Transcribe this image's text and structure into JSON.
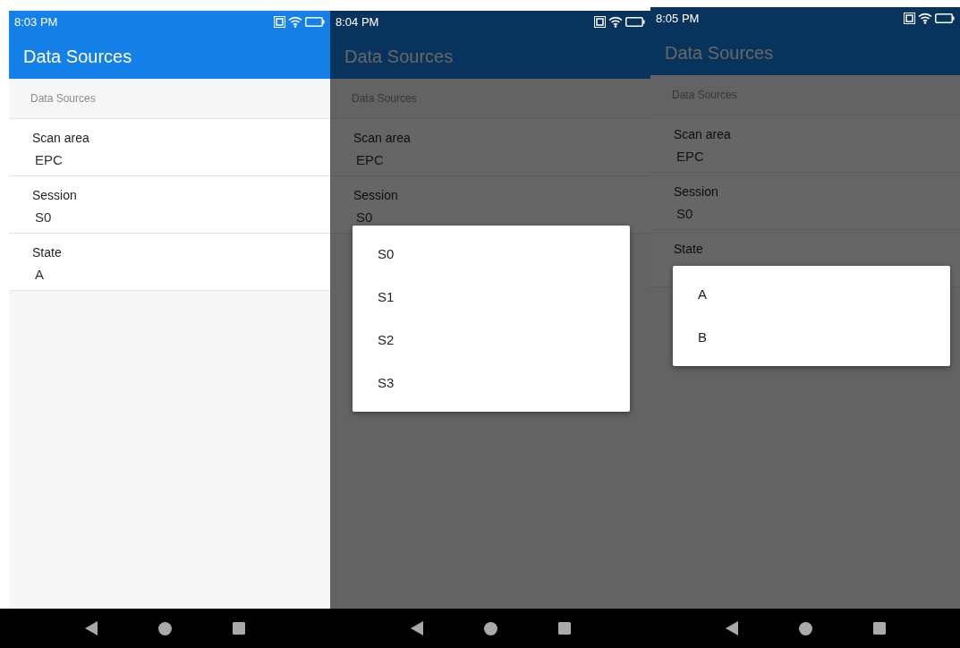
{
  "screens": [
    {
      "time": "8:03 PM",
      "title": "Data Sources",
      "dimmed": false,
      "section_header": "Data Sources",
      "items": [
        {
          "label": "Scan area",
          "value": "EPC"
        },
        {
          "label": "Session",
          "value": "S0"
        },
        {
          "label": "State",
          "value": "A"
        }
      ]
    },
    {
      "time": "8:04 PM",
      "title": "Data Sources",
      "dimmed": true,
      "section_header": "Data Sources",
      "items": [
        {
          "label": "Scan area",
          "value": "EPC"
        },
        {
          "label": "Session",
          "value": "S0"
        }
      ],
      "dropdown": {
        "options": [
          "S0",
          "S1",
          "S2",
          "S3"
        ]
      }
    },
    {
      "time": "8:05 PM",
      "title": "Data Sources",
      "dimmed": true,
      "section_header": "Data Sources",
      "items": [
        {
          "label": "Scan area",
          "value": "EPC"
        },
        {
          "label": "Session",
          "value": "S0"
        },
        {
          "label": "State"
        }
      ],
      "dropdown": {
        "options": [
          "A",
          "B"
        ]
      }
    }
  ]
}
